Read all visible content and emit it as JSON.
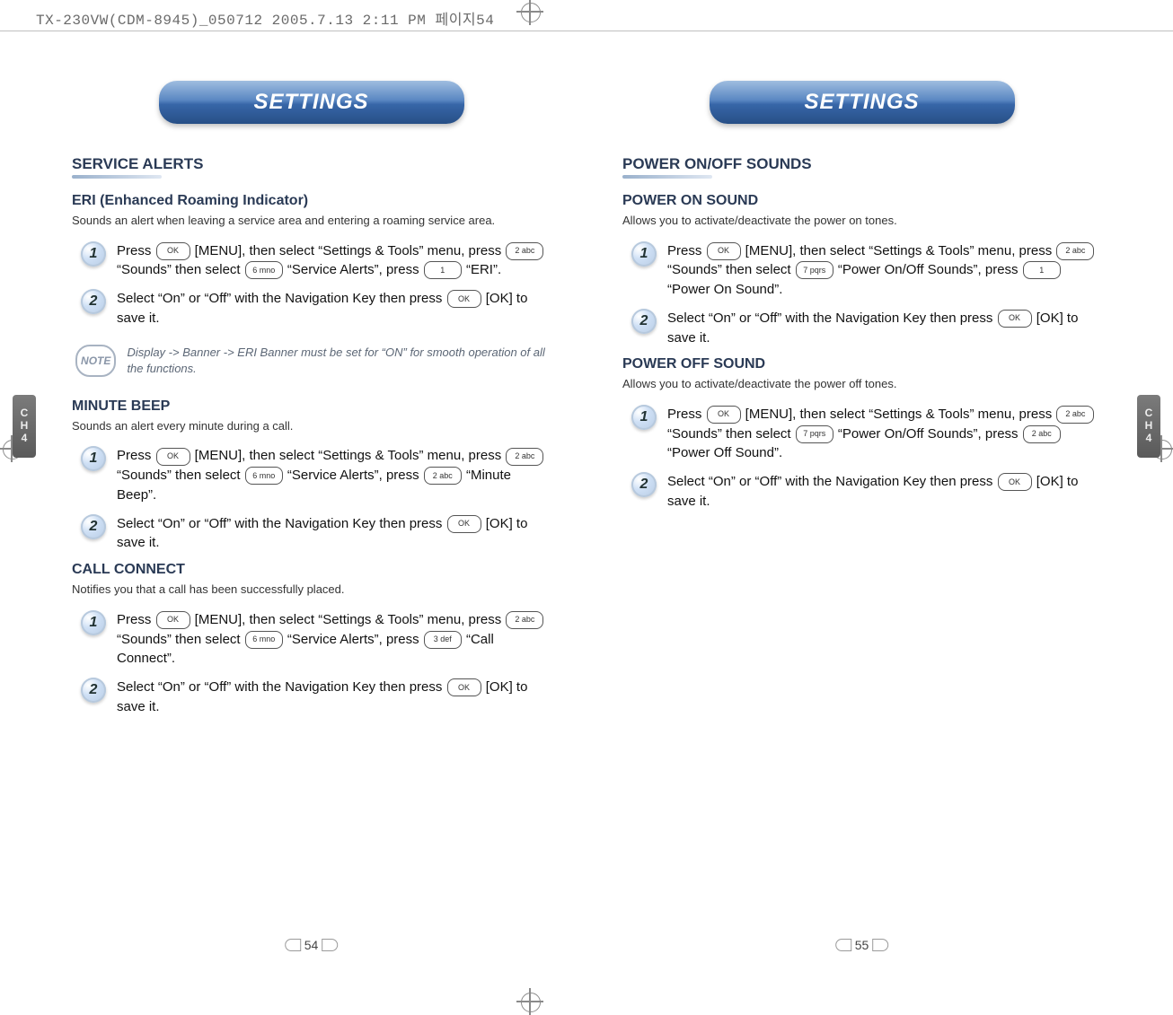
{
  "document_header": "TX-230VW(CDM-8945)_050712  2005.7.13  2:11 PM  페이지54",
  "chapter_tab": {
    "ch_lines": [
      "C",
      "H"
    ],
    "num": "4"
  },
  "keys": {
    "ok": "OK",
    "k1": "1",
    "k2": "2 abc",
    "k3": "3 def",
    "k6": "6 mno",
    "k7": "7 pqrs"
  },
  "left_page": {
    "title": "SETTINGS",
    "page_number": "54",
    "sections": [
      {
        "heading": "SERVICE ALERTS",
        "subsections": [
          {
            "subheading": "ERI (Enhanced Roaming Indicator)",
            "desc": "Sounds an alert when leaving a service area and entering a roaming service area.",
            "steps": [
              {
                "n": "1",
                "text_parts": [
                  "Press ",
                  " [MENU], then select “Settings & Tools” menu, press ",
                  " “Sounds” then select ",
                  " “Service Alerts”, press ",
                  " “ERI”."
                ],
                "keys": [
                  "ok",
                  "k2",
                  "k6",
                  "k1"
                ]
              },
              {
                "n": "2",
                "text_parts": [
                  "Select “On” or “Off” with the Navigation Key then press ",
                  " [OK] to save it."
                ],
                "keys": [
                  "ok"
                ]
              }
            ],
            "note": "Display -> Banner -> ERI Banner must be set for “ON” for smooth operation of all the functions."
          },
          {
            "subheading": "MINUTE BEEP",
            "desc": "Sounds an alert every minute during a call.",
            "steps": [
              {
                "n": "1",
                "text_parts": [
                  "Press ",
                  " [MENU], then select “Settings & Tools” menu, press ",
                  " “Sounds” then select ",
                  " “Service Alerts”, press ",
                  " “Minute Beep”."
                ],
                "keys": [
                  "ok",
                  "k2",
                  "k6",
                  "k2"
                ]
              },
              {
                "n": "2",
                "text_parts": [
                  "Select “On” or “Off” with the Navigation Key then press ",
                  " [OK] to save it."
                ],
                "keys": [
                  "ok"
                ]
              }
            ]
          },
          {
            "subheading": "CALL CONNECT",
            "desc": "Notifies you that a call has been successfully placed.",
            "steps": [
              {
                "n": "1",
                "text_parts": [
                  "Press ",
                  " [MENU], then select “Settings & Tools” menu, press ",
                  " “Sounds” then select ",
                  " “Service Alerts”, press ",
                  " “Call Connect”."
                ],
                "keys": [
                  "ok",
                  "k2",
                  "k6",
                  "k3"
                ]
              },
              {
                "n": "2",
                "text_parts": [
                  "Select “On” or “Off” with the Navigation Key then press ",
                  " [OK] to save it."
                ],
                "keys": [
                  "ok"
                ]
              }
            ]
          }
        ]
      }
    ]
  },
  "right_page": {
    "title": "SETTINGS",
    "page_number": "55",
    "sections": [
      {
        "heading": "POWER ON/OFF SOUNDS",
        "subsections": [
          {
            "subheading": "POWER ON SOUND",
            "desc": "Allows you to activate/deactivate the power on tones.",
            "steps": [
              {
                "n": "1",
                "text_parts": [
                  "Press ",
                  " [MENU], then select “Settings & Tools” menu, press ",
                  " “Sounds” then select ",
                  " “Power On/Off Sounds”, press ",
                  " “Power On Sound”."
                ],
                "keys": [
                  "ok",
                  "k2",
                  "k7",
                  "k1"
                ]
              },
              {
                "n": "2",
                "text_parts": [
                  "Select “On” or “Off” with the Navigation Key then press ",
                  " [OK] to save it."
                ],
                "keys": [
                  "ok"
                ]
              }
            ]
          },
          {
            "subheading": "POWER OFF SOUND",
            "desc": "Allows you to activate/deactivate the power off tones.",
            "steps": [
              {
                "n": "1",
                "text_parts": [
                  "Press ",
                  " [MENU], then select “Settings & Tools” menu, press ",
                  " “Sounds” then select ",
                  " “Power On/Off Sounds”, press ",
                  " “Power Off Sound”."
                ],
                "keys": [
                  "ok",
                  "k2",
                  "k7",
                  "k2"
                ]
              },
              {
                "n": "2",
                "text_parts": [
                  "Select “On” or “Off” with the Navigation Key then press ",
                  " [OK] to save it."
                ],
                "keys": [
                  "ok"
                ]
              }
            ]
          }
        ]
      }
    ]
  },
  "note_label": "NOTE"
}
